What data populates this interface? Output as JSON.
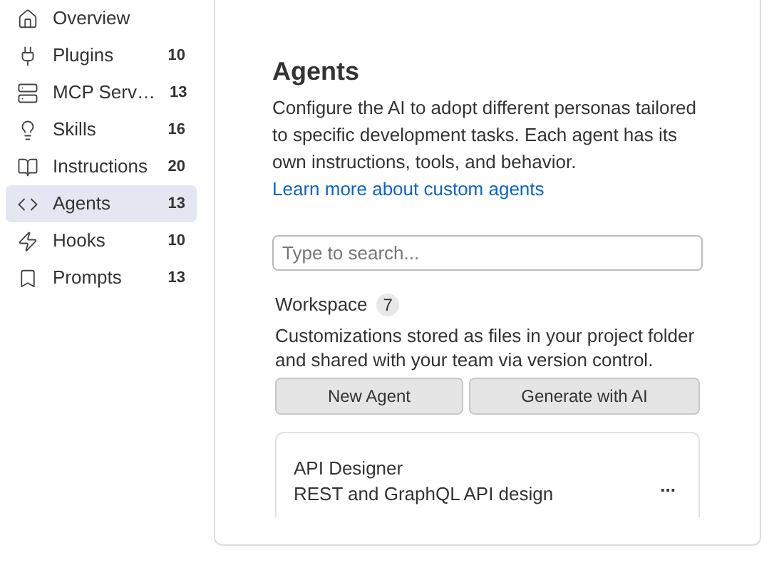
{
  "sidebar": {
    "items": [
      {
        "label": "Overview",
        "selected": false
      },
      {
        "label": "Plugins",
        "count": "10",
        "selected": false
      },
      {
        "label": "MCP Serv…",
        "count": "13",
        "selected": false
      },
      {
        "label": "Skills",
        "count": "16",
        "selected": false
      },
      {
        "label": "Instructions",
        "count": "20",
        "selected": false
      },
      {
        "label": "Agents",
        "count": "13",
        "selected": true
      },
      {
        "label": "Hooks",
        "count": "10",
        "selected": false
      },
      {
        "label": "Prompts",
        "count": "13",
        "selected": false
      }
    ]
  },
  "main": {
    "title": "Agents",
    "description": "Configure the AI to adopt different personas tailored to specific development tasks. Each agent has its own instructions, tools, and behavior.",
    "link": "Learn more about custom agents",
    "search": {
      "placeholder": "Type to search..."
    },
    "section": {
      "title": "Workspace",
      "count": "7",
      "description": "Customizations stored as files in your project folder and shared with your team via version control.",
      "buttons": [
        "New Agent",
        "Generate with AI"
      ],
      "items": [
        {
          "name": "API Designer",
          "description": "REST and GraphQL API design",
          "menu": "..."
        }
      ]
    }
  }
}
